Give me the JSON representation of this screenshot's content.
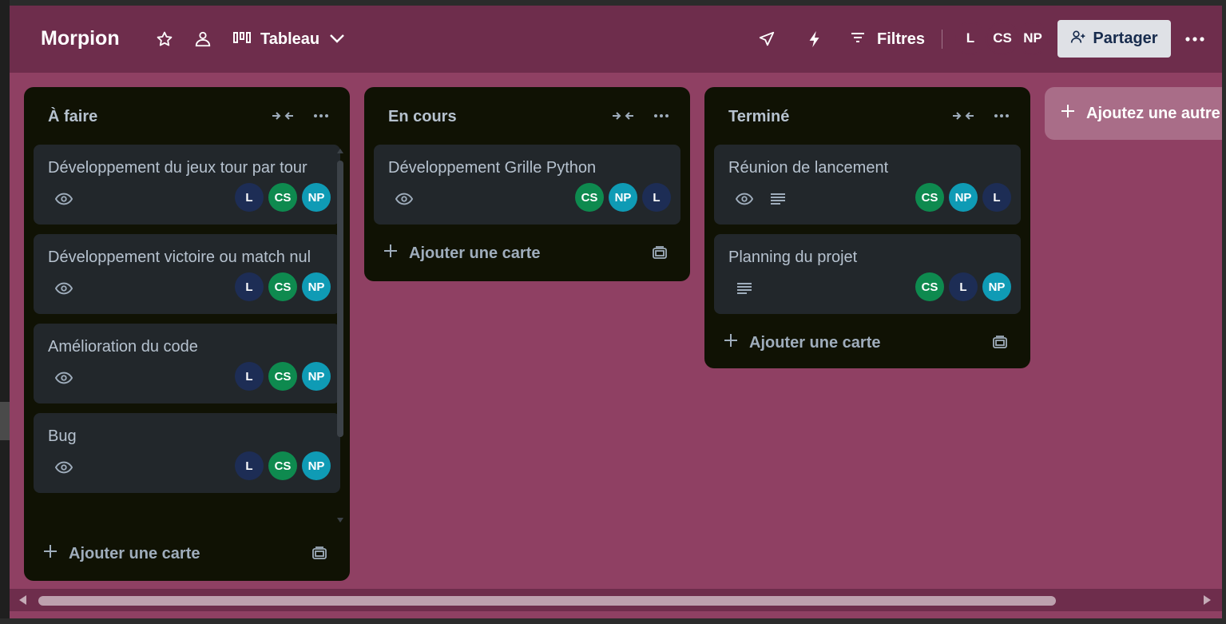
{
  "board": {
    "title": "Morpion",
    "view_label": "Tableau",
    "filter_label": "Filtres",
    "share_label": "Partager",
    "members": [
      {
        "initials": "L",
        "color": "#1d2d55"
      },
      {
        "initials": "CS",
        "color": "#0e8a4f"
      },
      {
        "initials": "NP",
        "color": "#0f9bb5"
      }
    ]
  },
  "colors": {
    "background": "#8f4063",
    "header": "#6e2d4c",
    "list": "#101204",
    "card": "#22272b",
    "avatar_L": "#1d2d55",
    "avatar_CS": "#0e8a4f",
    "avatar_NP": "#0f9bb5"
  },
  "lists": [
    {
      "title": "À faire",
      "add_card_label": "Ajouter une carte",
      "cards": [
        {
          "title": "Développement du jeux tour par tour",
          "badges": [
            "eye-icon"
          ],
          "avatars": [
            "L",
            "CS",
            "NP"
          ]
        },
        {
          "title": "Développement victoire ou match nul",
          "badges": [
            "eye-icon"
          ],
          "avatars": [
            "L",
            "CS",
            "NP"
          ]
        },
        {
          "title": "Amélioration du code",
          "badges": [
            "eye-icon"
          ],
          "avatars": [
            "L",
            "CS",
            "NP"
          ]
        },
        {
          "title": "Bug",
          "badges": [
            "eye-icon"
          ],
          "avatars": [
            "L",
            "CS",
            "NP"
          ]
        }
      ]
    },
    {
      "title": "En cours",
      "add_card_label": "Ajouter une carte",
      "cards": [
        {
          "title": "Développement Grille Python",
          "badges": [
            "eye-icon"
          ],
          "avatars": [
            "CS",
            "NP",
            "L"
          ]
        }
      ]
    },
    {
      "title": "Terminé",
      "add_card_label": "Ajouter une carte",
      "cards": [
        {
          "title": "Réunion de lancement",
          "badges": [
            "eye-icon",
            "description-icon"
          ],
          "avatars": [
            "CS",
            "NP",
            "L"
          ]
        },
        {
          "title": "Planning du projet",
          "badges": [
            "description-icon"
          ],
          "avatars": [
            "CS",
            "L",
            "NP"
          ]
        }
      ]
    }
  ],
  "add_list_label": "Ajoutez une autre liste"
}
